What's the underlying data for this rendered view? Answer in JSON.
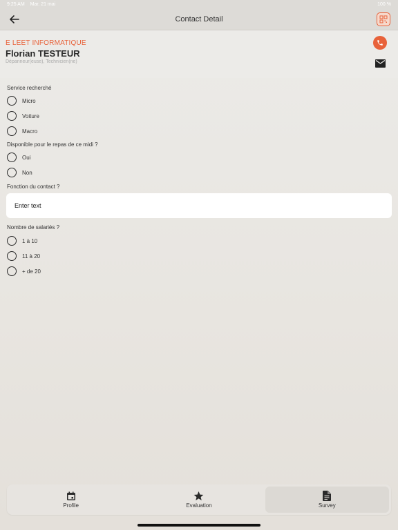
{
  "statusbar": {
    "time": "9:25 AM",
    "date": "Mar. 21 mai",
    "battery": "100 %"
  },
  "navbar": {
    "title": "Contact Detail"
  },
  "contact": {
    "company": "E LEET INFORMATIQUE",
    "name": "Florian TESTEUR",
    "role": "Dépanneur(euse), Technicien(ne)"
  },
  "form": {
    "q1": {
      "label": "Service recherché",
      "options": [
        "Micro",
        "Voiture",
        "Macro"
      ]
    },
    "q2": {
      "label": "Disponible pour le repas de ce midi ?",
      "options": [
        "Oui",
        "Non"
      ]
    },
    "q3": {
      "label": "Fonction du contact ?",
      "placeholder": "Enter text"
    },
    "q4": {
      "label": "Nombre de salariés ?",
      "options": [
        "1 à 10",
        "11 à 20",
        "+ de 20"
      ]
    }
  },
  "tabs": [
    {
      "label": "Profile",
      "icon": "calendar-icon"
    },
    {
      "label": "Evaluation",
      "icon": "star-icon"
    },
    {
      "label": "Survey",
      "icon": "document-icon"
    }
  ],
  "colors": {
    "accent": "#e8623a"
  }
}
